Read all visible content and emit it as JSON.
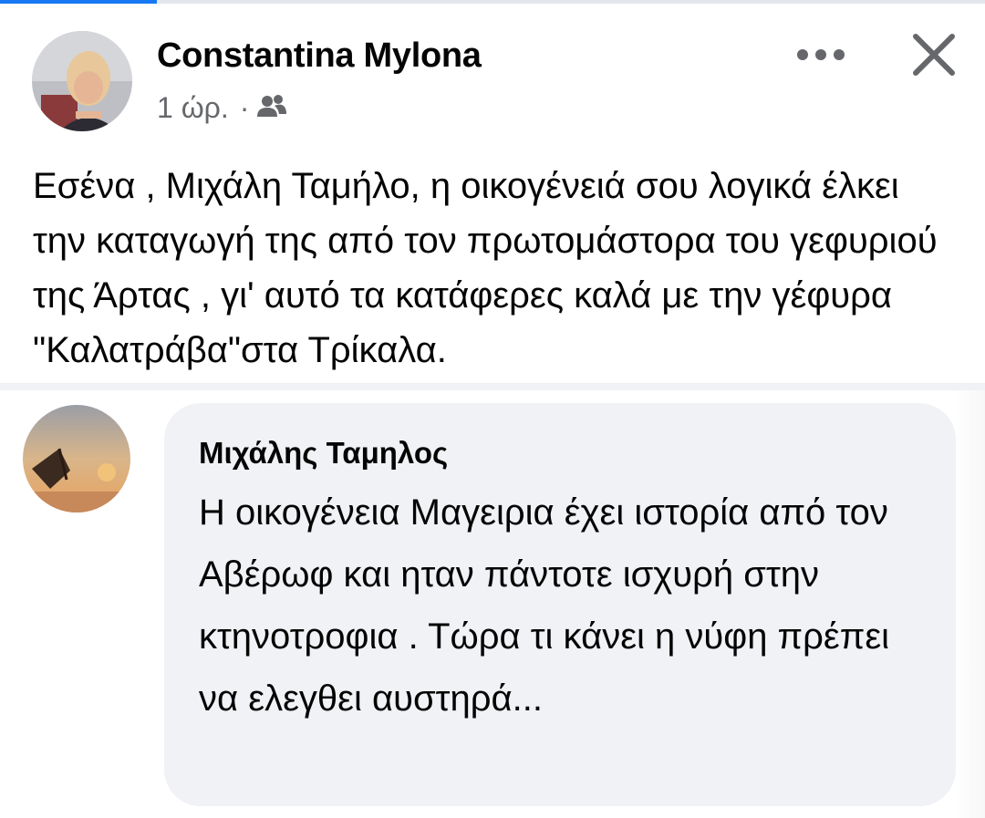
{
  "post": {
    "author": "Constantina Mylona",
    "time": "1 ώρ.",
    "separator": "·",
    "audience_icon": "friends-icon",
    "text": "Εσένα , Μιχάλη Ταμήλο, η οικογένειά σου λογικά έλκει την καταγωγή της από τον πρωτομάστορα του γεφυριού της Άρτας , γι' αυτό τα κατάφερες καλά με την γέφυρα \"Καλατράβα\"στα Τρίκαλα.",
    "more_icon": "more-options-icon",
    "close_icon": "close-icon"
  },
  "comment": {
    "author": "Μιχάλης Ταμηλος",
    "text": "Η οικογένεια Μαγειρια έχει ιστορία από  τον Αβέρωφ και ηταν πάντοτε ισχυρή στην κτηνοτροφια . Τώρα τι κάνει η νύφη πρέπει να ελεγθει αυστηρά..."
  },
  "colors": {
    "accent": "#1877f2",
    "text_primary": "#050505",
    "text_secondary": "#65676b",
    "bubble_bg": "#f0f2f5"
  }
}
